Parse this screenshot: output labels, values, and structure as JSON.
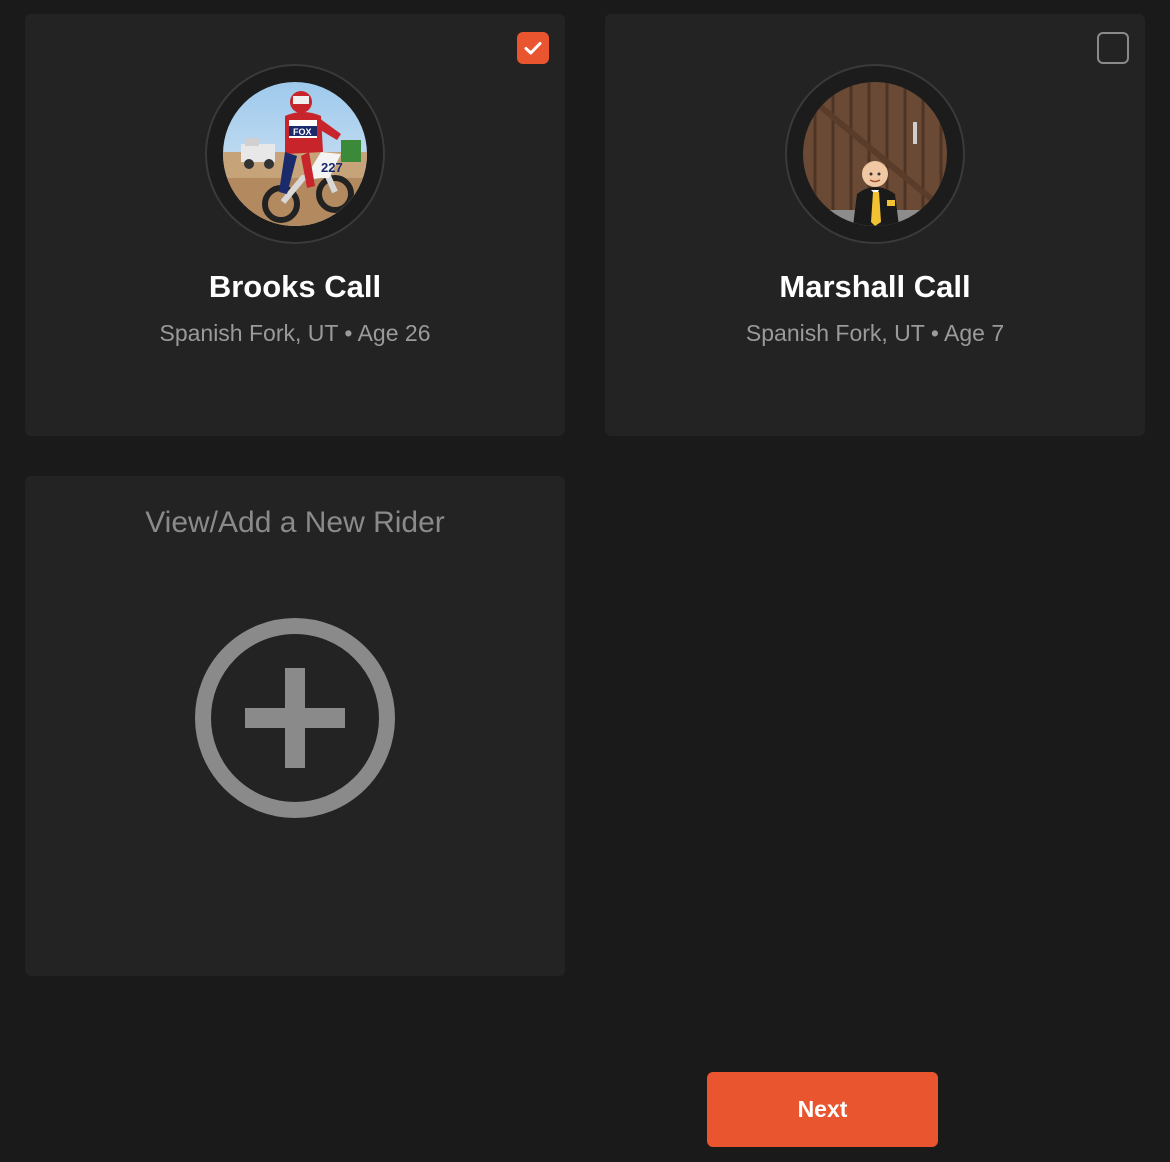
{
  "riders": [
    {
      "name": "Brooks Call",
      "location": "Spanish Fork, UT",
      "separator": "•",
      "age_label": "Age 26",
      "selected": true,
      "photo": "rider-photo-motocross"
    },
    {
      "name": "Marshall Call",
      "location": "Spanish Fork, UT",
      "separator": "•",
      "age_label": "Age 7",
      "selected": false,
      "photo": "rider-photo-boy-suit"
    }
  ],
  "add_rider": {
    "title": "View/Add a New Rider",
    "icon": "plus-circle-icon"
  },
  "next_button": {
    "label": "Next"
  },
  "colors": {
    "background": "#1a1a1a",
    "card": "#232323",
    "accent": "#e9552f",
    "muted_text": "#9a9a9a",
    "icon_gray": "#8a8a8a"
  }
}
